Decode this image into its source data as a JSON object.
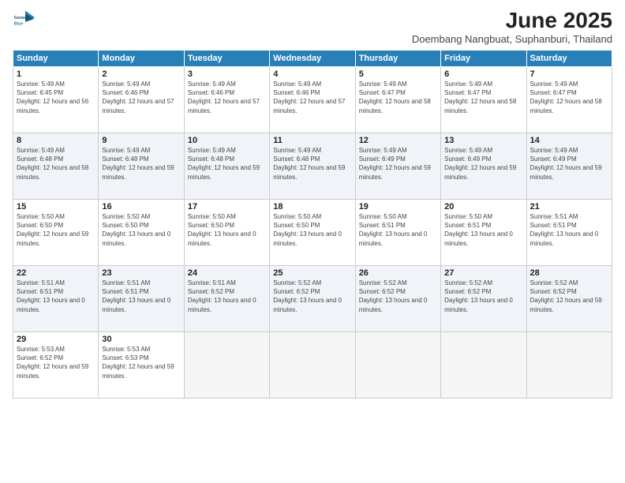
{
  "logo": {
    "line1": "General",
    "line2": "Blue"
  },
  "title": "June 2025",
  "location": "Doembang Nangbuat, Suphanburi, Thailand",
  "days_of_week": [
    "Sunday",
    "Monday",
    "Tuesday",
    "Wednesday",
    "Thursday",
    "Friday",
    "Saturday"
  ],
  "weeks": [
    [
      {
        "day": "1",
        "sunrise": "5:49 AM",
        "sunset": "6:45 PM",
        "daylight": "12 hours and 56 minutes."
      },
      {
        "day": "2",
        "sunrise": "5:49 AM",
        "sunset": "6:46 PM",
        "daylight": "12 hours and 57 minutes."
      },
      {
        "day": "3",
        "sunrise": "5:49 AM",
        "sunset": "6:46 PM",
        "daylight": "12 hours and 57 minutes."
      },
      {
        "day": "4",
        "sunrise": "5:49 AM",
        "sunset": "6:46 PM",
        "daylight": "12 hours and 57 minutes."
      },
      {
        "day": "5",
        "sunrise": "5:49 AM",
        "sunset": "6:47 PM",
        "daylight": "12 hours and 58 minutes."
      },
      {
        "day": "6",
        "sunrise": "5:49 AM",
        "sunset": "6:47 PM",
        "daylight": "12 hours and 58 minutes."
      },
      {
        "day": "7",
        "sunrise": "5:49 AM",
        "sunset": "6:47 PM",
        "daylight": "12 hours and 58 minutes."
      }
    ],
    [
      {
        "day": "8",
        "sunrise": "5:49 AM",
        "sunset": "6:48 PM",
        "daylight": "12 hours and 58 minutes."
      },
      {
        "day": "9",
        "sunrise": "5:49 AM",
        "sunset": "6:48 PM",
        "daylight": "12 hours and 59 minutes."
      },
      {
        "day": "10",
        "sunrise": "5:49 AM",
        "sunset": "6:48 PM",
        "daylight": "12 hours and 59 minutes."
      },
      {
        "day": "11",
        "sunrise": "5:49 AM",
        "sunset": "6:48 PM",
        "daylight": "12 hours and 59 minutes."
      },
      {
        "day": "12",
        "sunrise": "5:49 AM",
        "sunset": "6:49 PM",
        "daylight": "12 hours and 59 minutes."
      },
      {
        "day": "13",
        "sunrise": "5:49 AM",
        "sunset": "6:49 PM",
        "daylight": "12 hours and 59 minutes."
      },
      {
        "day": "14",
        "sunrise": "5:49 AM",
        "sunset": "6:49 PM",
        "daylight": "12 hours and 59 minutes."
      }
    ],
    [
      {
        "day": "15",
        "sunrise": "5:50 AM",
        "sunset": "6:50 PM",
        "daylight": "12 hours and 59 minutes."
      },
      {
        "day": "16",
        "sunrise": "5:50 AM",
        "sunset": "6:50 PM",
        "daylight": "13 hours and 0 minutes."
      },
      {
        "day": "17",
        "sunrise": "5:50 AM",
        "sunset": "6:50 PM",
        "daylight": "13 hours and 0 minutes."
      },
      {
        "day": "18",
        "sunrise": "5:50 AM",
        "sunset": "6:50 PM",
        "daylight": "13 hours and 0 minutes."
      },
      {
        "day": "19",
        "sunrise": "5:50 AM",
        "sunset": "6:51 PM",
        "daylight": "13 hours and 0 minutes."
      },
      {
        "day": "20",
        "sunrise": "5:50 AM",
        "sunset": "6:51 PM",
        "daylight": "13 hours and 0 minutes."
      },
      {
        "day": "21",
        "sunrise": "5:51 AM",
        "sunset": "6:51 PM",
        "daylight": "13 hours and 0 minutes."
      }
    ],
    [
      {
        "day": "22",
        "sunrise": "5:51 AM",
        "sunset": "6:51 PM",
        "daylight": "13 hours and 0 minutes."
      },
      {
        "day": "23",
        "sunrise": "5:51 AM",
        "sunset": "6:51 PM",
        "daylight": "13 hours and 0 minutes."
      },
      {
        "day": "24",
        "sunrise": "5:51 AM",
        "sunset": "6:52 PM",
        "daylight": "13 hours and 0 minutes."
      },
      {
        "day": "25",
        "sunrise": "5:52 AM",
        "sunset": "6:52 PM",
        "daylight": "13 hours and 0 minutes."
      },
      {
        "day": "26",
        "sunrise": "5:52 AM",
        "sunset": "6:52 PM",
        "daylight": "13 hours and 0 minutes."
      },
      {
        "day": "27",
        "sunrise": "5:52 AM",
        "sunset": "6:52 PM",
        "daylight": "13 hours and 0 minutes."
      },
      {
        "day": "28",
        "sunrise": "5:52 AM",
        "sunset": "6:52 PM",
        "daylight": "12 hours and 59 minutes."
      }
    ],
    [
      {
        "day": "29",
        "sunrise": "5:53 AM",
        "sunset": "6:52 PM",
        "daylight": "12 hours and 59 minutes."
      },
      {
        "day": "30",
        "sunrise": "5:53 AM",
        "sunset": "6:53 PM",
        "daylight": "12 hours and 59 minutes."
      },
      null,
      null,
      null,
      null,
      null
    ]
  ],
  "labels": {
    "sunrise_prefix": "Sunrise: ",
    "sunset_prefix": "Sunset: ",
    "daylight_prefix": "Daylight: "
  }
}
